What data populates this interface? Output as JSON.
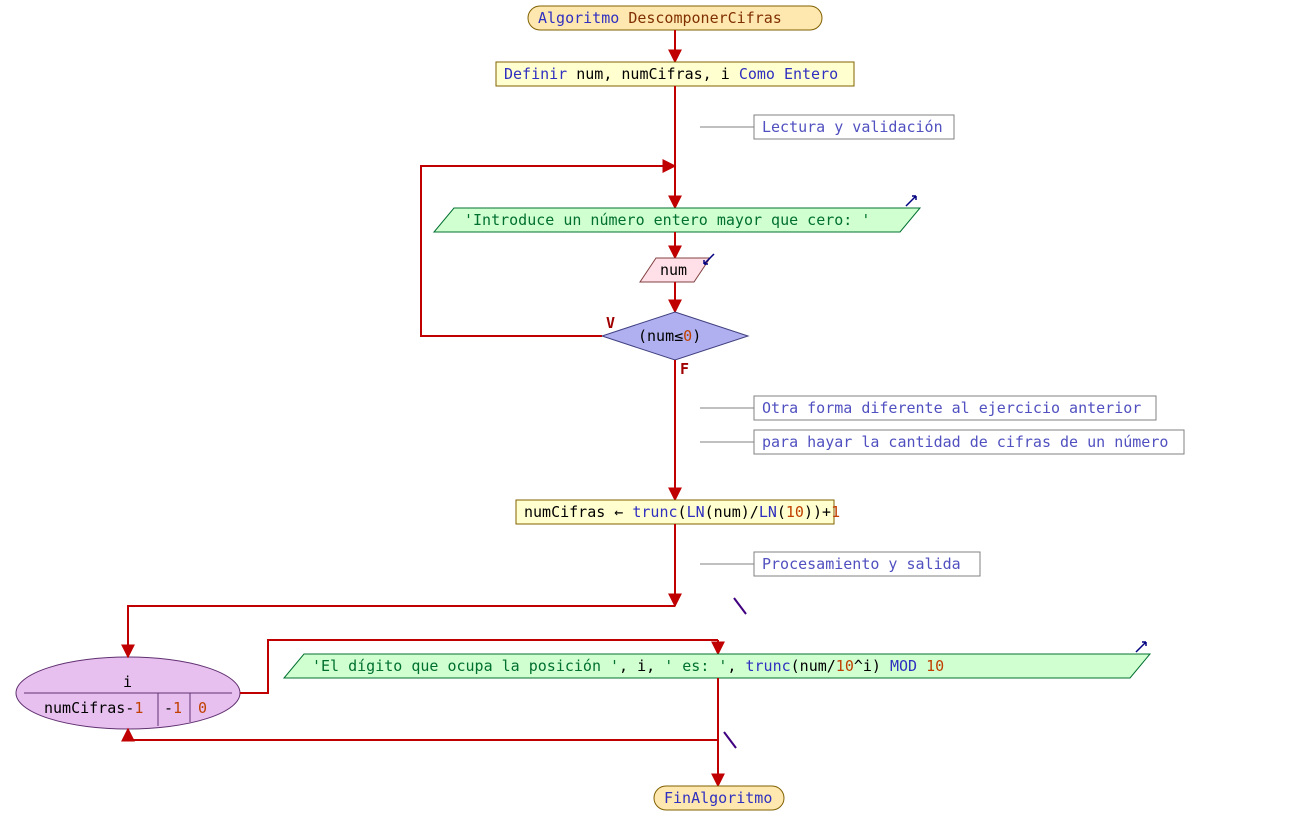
{
  "title_kw": "Algoritmo",
  "title_name": "DescomponerCifras",
  "define_kw1": "Definir",
  "define_vars": "num, numCifras, i",
  "define_kw2": "Como Entero",
  "comment1": "Lectura y validación",
  "io_prompt": "'Introduce un número entero mayor que cero: '",
  "io_read": "num",
  "decision_l": "(num≤",
  "decision_z": "0",
  "decision_r": ")",
  "label_true": "V",
  "label_false": "F",
  "comment2": "Otra forma diferente al ejercicio anterior",
  "comment3": "para hayar la cantidad de cifras de un número",
  "assign_lhs": "numCifras ←",
  "assign_fn1": "trunc",
  "assign_paren1": "(",
  "assign_fn2": "LN",
  "assign_paren2": "(num)/",
  "assign_fn3": "LN",
  "assign_paren3": "(",
  "assign_ten": "10",
  "assign_paren4": "))+",
  "assign_one": "1",
  "comment4": "Procesamiento y salida",
  "loop_var": "i",
  "loop_from_a": "numCifras-",
  "loop_from_b": "1",
  "loop_step": "-1",
  "loop_to": "0",
  "out_str1": "'El dígito que ocupa la posición '",
  "out_mid1": ", i, ",
  "out_str2": "' es: '",
  "out_mid2": ", ",
  "out_fn": "trunc",
  "out_paren1": "(num/",
  "out_ten": "10",
  "out_caret": "^i)",
  "out_mod": "MOD",
  "out_modn": "10",
  "end_kw": "FinAlgoritmo"
}
